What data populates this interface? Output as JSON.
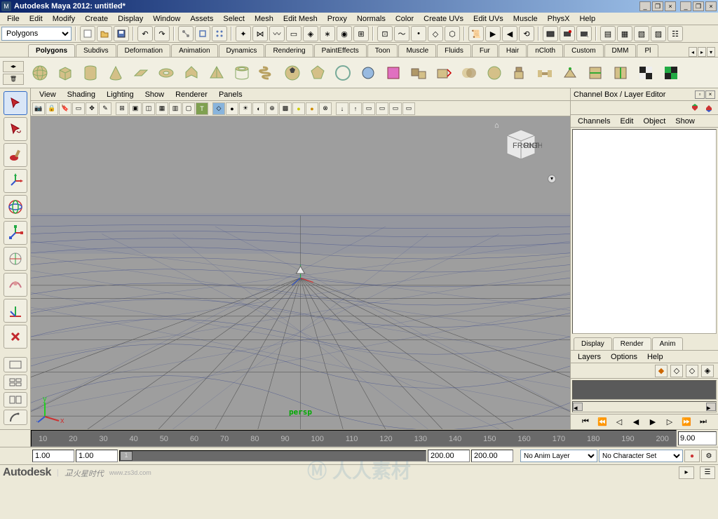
{
  "window": {
    "title": "Autodesk Maya 2012: untitled*"
  },
  "menus": [
    "File",
    "Edit",
    "Modify",
    "Create",
    "Display",
    "Window",
    "Assets",
    "Select",
    "Mesh",
    "Edit Mesh",
    "Proxy",
    "Normals",
    "Color",
    "Create UVs",
    "Edit UVs",
    "Muscle",
    "PhysX",
    "Help"
  ],
  "mode_select": "Polygons",
  "shelf_tabs": [
    "Polygons",
    "Subdivs",
    "Deformation",
    "Animation",
    "Dynamics",
    "Rendering",
    "PaintEffects",
    "Toon",
    "Muscle",
    "Fluids",
    "Fur",
    "Hair",
    "nCloth",
    "Custom",
    "DMM",
    "Pl"
  ],
  "shelf_active": 0,
  "panel_menus": [
    "View",
    "Shading",
    "Lighting",
    "Show",
    "Renderer",
    "Panels"
  ],
  "viewport": {
    "persp_label": "persp",
    "cube_front": "FRONT",
    "cube_right": "RIGHT"
  },
  "channelbox": {
    "title": "Channel Box / Layer Editor",
    "menu": [
      "Channels",
      "Edit",
      "Object",
      "Show"
    ],
    "layer_tabs": [
      "Display",
      "Render",
      "Anim"
    ],
    "layer_menu": [
      "Layers",
      "Options",
      "Help"
    ]
  },
  "timeline": {
    "ticks": [
      "10",
      "20",
      "30",
      "40",
      "50",
      "60",
      "70",
      "80",
      "90",
      "100",
      "110",
      "120",
      "130",
      "140",
      "150",
      "160",
      "170",
      "180",
      "190",
      "200"
    ],
    "current_frame": "9.00"
  },
  "range": {
    "start_outer": "1.00",
    "start_inner": "1.00",
    "knob": "1",
    "end_inner": "200.00",
    "end_outer": "200.00",
    "anim_layer": "No Anim Layer",
    "char_set": "No Character Set"
  },
  "footer": {
    "brand": "Autodesk",
    "brand2": "火星时代",
    "url": "www.zs3d.com"
  }
}
